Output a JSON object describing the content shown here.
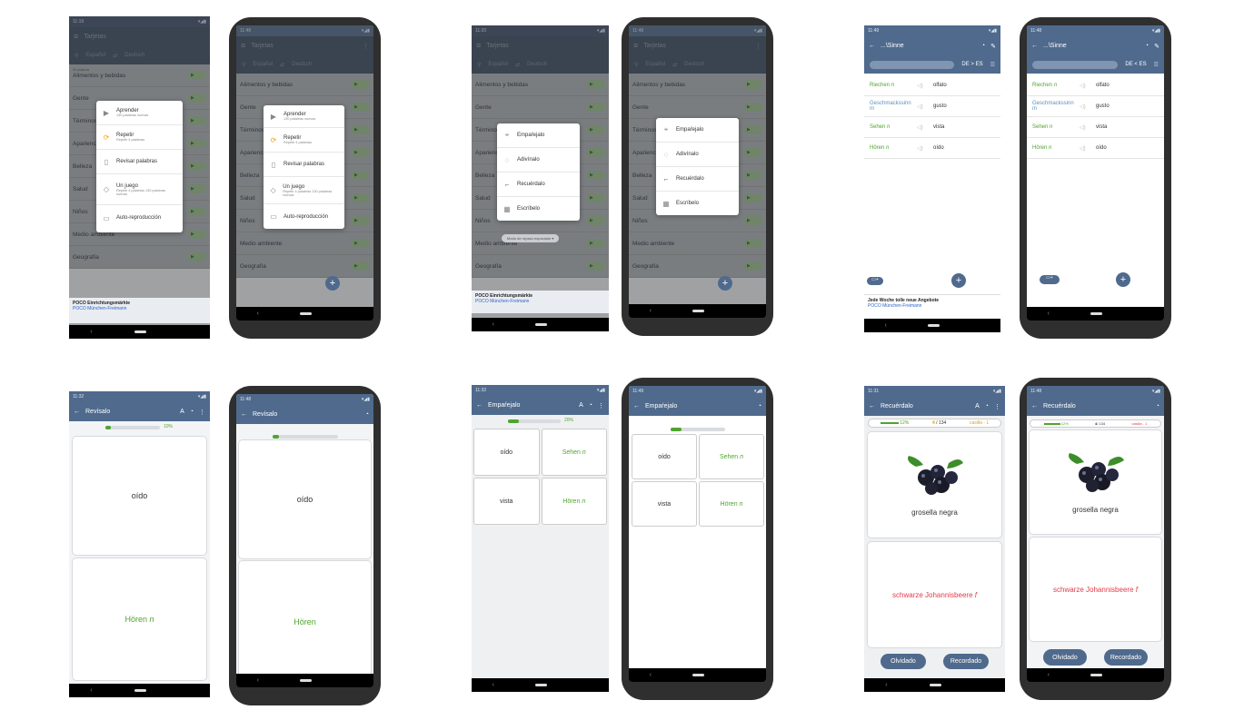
{
  "status_times": [
    "11:19",
    "11:48",
    "11:20",
    "11:48",
    "11:49",
    "11:48",
    "11:32",
    "11:48",
    "11:32",
    "11:49",
    "11:31",
    "11:48"
  ],
  "cards_screen": {
    "title": "Tarjetas",
    "lang_from": "Español",
    "lang_to": "Deutsch",
    "categories": [
      {
        "count": "50 palabras",
        "name": "Alimentos y bebidas",
        "pct": "0%"
      },
      {
        "count": "",
        "name": "Gente",
        "pct": "0%"
      },
      {
        "count": "",
        "name": "Términos",
        "pct": "0%"
      },
      {
        "count": "",
        "name": "Apariencia",
        "pct": "0%"
      },
      {
        "count": "",
        "name": "Belleza",
        "pct": "0%"
      },
      {
        "count": "",
        "name": "Salud",
        "pct": "0%"
      },
      {
        "count": "",
        "name": "Niños",
        "pct": "0%"
      },
      {
        "count": "",
        "name": "Medio ambiente",
        "pct": "0%"
      },
      {
        "count": "",
        "name": "Geografía",
        "pct": "0%"
      }
    ],
    "words_badge": "4 palabras",
    "ad_title": "POCO Einrichtungsmärkte",
    "ad_sub": "POCO München-Freimann"
  },
  "learn_menu": [
    {
      "icon": "play-icon",
      "label": "Aprender",
      "sub": "130 palabras nuevas"
    },
    {
      "icon": "repeat-icon",
      "label": "Repetir",
      "sub": "Repetir 4 palabras"
    },
    {
      "icon": "cards-icon",
      "label": "Revisar palabras",
      "sub": ""
    },
    {
      "icon": "game-icon",
      "label": "Un juego",
      "sub": "Repetir 4 palabras 130 palabras nuevas"
    },
    {
      "icon": "autoplay-icon",
      "label": "Auto-reproducción",
      "sub": ""
    }
  ],
  "game_menu": [
    {
      "icon": "match-icon",
      "label": "Empaŕejalo"
    },
    {
      "icon": "guess-icon",
      "label": "Adivínalo"
    },
    {
      "icon": "recall-icon",
      "label": "Recuérdalo"
    },
    {
      "icon": "keyboard-icon",
      "label": "Escríbelo"
    }
  ],
  "spaced_mode": "Modo de repaso espaciado",
  "sinne": {
    "title": "...\\Sinne",
    "direction": "DE > ES",
    "direction_alt": "DE < ES",
    "words": [
      {
        "de": "Riechen",
        "g": "n",
        "es": "olfato"
      },
      {
        "de": "Geschmackssinn",
        "g": "m",
        "es": "gusto"
      },
      {
        "de": "Sehen",
        "g": "n",
        "es": "vista"
      },
      {
        "de": "Hören",
        "g": "n",
        "es": "oído"
      }
    ],
    "ad_title": "Jede Woche tolle neue Angebote",
    "ad_sub": "POCO München-Freimann"
  },
  "revisalo": {
    "title": "Revísalo",
    "progress_label": "10%",
    "progress": 0.1,
    "front": "oído",
    "back": "Hören",
    "gender": "n"
  },
  "emparejalo": {
    "title": "Empaŕejalo",
    "progress_label": "20%",
    "progress": 0.2,
    "pairs": [
      {
        "left": "oído",
        "right": "Sehen",
        "g": "n"
      },
      {
        "left": "vista",
        "right": "Hören",
        "g": "n"
      }
    ]
  },
  "recuerdalo": {
    "title": "Recuérdalo",
    "progress_label": "12%",
    "counter": "4",
    "total": "/ 134",
    "box": "casilla - 1",
    "word": "grosella negra",
    "translation": "schwarze Johannisbeere",
    "gender": "f",
    "forgot": "Olvidado",
    "remembered": "Recordado"
  }
}
